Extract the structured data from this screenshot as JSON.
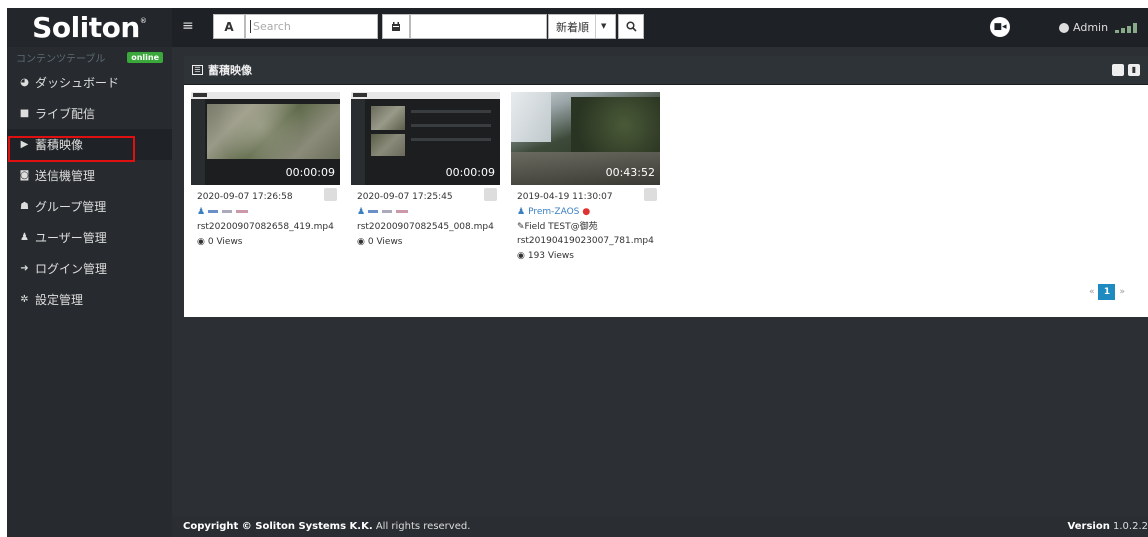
{
  "header": {
    "logo_text": "Soliton",
    "font_toggle_label": "A",
    "search_placeholder": "Search",
    "date_value": "",
    "sort_label": "新着順",
    "admin_label": "Admin"
  },
  "sidebar": {
    "status_label": "コンテンツテーブル",
    "status_badge": "online",
    "items": [
      {
        "label": "ダッシュボード",
        "icon": "dashboard-icon"
      },
      {
        "label": "ライブ配信",
        "icon": "video-camera-icon"
      },
      {
        "label": "蓄積映像",
        "icon": "youtube-play-icon"
      },
      {
        "label": "送信機管理",
        "icon": "camera-icon"
      },
      {
        "label": "グループ管理",
        "icon": "users-icon"
      },
      {
        "label": "ユーザー管理",
        "icon": "user-icon"
      },
      {
        "label": "ログイン管理",
        "icon": "sign-in-icon"
      },
      {
        "label": "設定管理",
        "icon": "cogs-icon"
      }
    ],
    "active_index": 2
  },
  "panel": {
    "title": "蓄積映像"
  },
  "videos": [
    {
      "duration": "00:00:09",
      "date": "2020-09-07 17:26:58",
      "user": "",
      "note": "",
      "filename": "rst20200907082658_419.mp4",
      "views": "0 Views"
    },
    {
      "duration": "00:00:09",
      "date": "2020-09-07 17:25:45",
      "user": "",
      "note": "",
      "filename": "rst20200907082545_008.mp4",
      "views": "0 Views"
    },
    {
      "duration": "00:43:52",
      "date": "2019-04-19 11:30:07",
      "user": "Prem-ZAOS",
      "note": "Field TEST@御苑",
      "filename": "rst20190419023007_781.mp4",
      "views": "193 Views"
    }
  ],
  "pagination": {
    "prev": "«",
    "current": "1",
    "next": "»"
  },
  "footer": {
    "copyright_prefix": "Copyright © ",
    "company": "Soliton Systems K.K.",
    "copyright_suffix": " All rights reserved.",
    "version_label": "Version",
    "version_value": "1.0.2.2"
  }
}
